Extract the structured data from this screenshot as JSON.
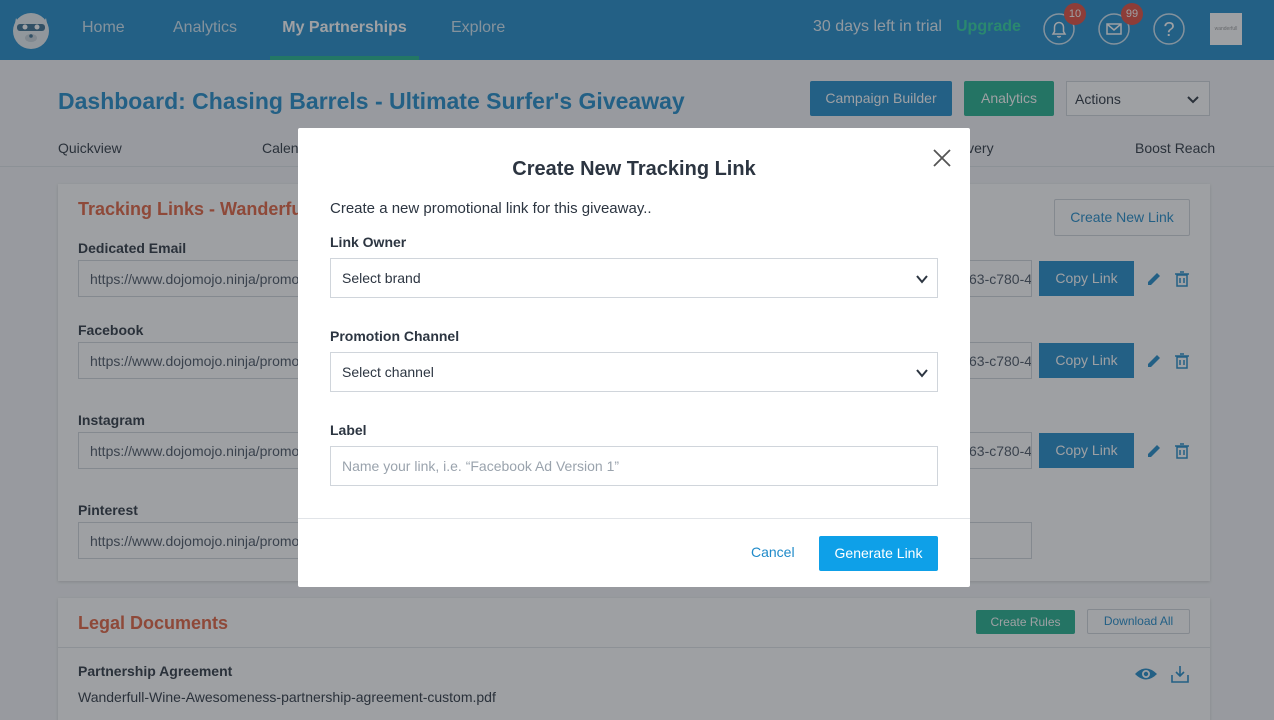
{
  "nav": {
    "items": [
      {
        "label": "Home"
      },
      {
        "label": "Analytics"
      },
      {
        "label": "My Partnerships"
      },
      {
        "label": "Explore"
      }
    ],
    "trial_text": "30 days left in trial",
    "upgrade_label": "Upgrade",
    "notifications_count": "10",
    "messages_count": "99",
    "avatar_text": "wanderfull"
  },
  "dashboard": {
    "title": "Dashboard: Chasing Barrels - Ultimate Surfer's Giveaway",
    "campaign_builder_label": "Campaign Builder",
    "analytics_label": "Analytics",
    "actions_label": "Actions",
    "tabs": {
      "quickview": "Quickview",
      "calendar": "Calendar",
      "delivery": "Delivery",
      "boost_reach": "Boost Reach"
    }
  },
  "tracking": {
    "title": "Tracking Links - Wanderfull",
    "create_new_label": "Create New Link",
    "copy_label": "Copy Link",
    "links": [
      {
        "label": "Dedicated Email",
        "url": "https://www.dojomojo.ninja/promo",
        "url_tail": "63-c780-42"
      },
      {
        "label": "Facebook",
        "url": "https://www.dojomojo.ninja/promo",
        "url_tail": "63-c780-42"
      },
      {
        "label": "Instagram",
        "url": "https://www.dojomojo.ninja/promo",
        "url_tail": "63-c780-42"
      },
      {
        "label": "Pinterest",
        "url": "https://www.dojomojo.ninja/promo",
        "url_tail": ""
      }
    ]
  },
  "legal": {
    "title": "Legal Documents",
    "create_rules_label": "Create Rules",
    "download_all_label": "Download All",
    "doc_title": "Partnership Agreement",
    "doc_file": "Wanderfull-Wine-Awesomeness-partnership-agreement-custom.pdf"
  },
  "modal": {
    "title": "Create New Tracking Link",
    "description": "Create a new promotional link for this giveaway..",
    "owner_label": "Link Owner",
    "owner_value": "Select brand",
    "channel_label": "Promotion Channel",
    "channel_value": "Select channel",
    "label_label": "Label",
    "label_placeholder": "Name your link, i.e. “Facebook Ad Version 1”",
    "cancel_label": "Cancel",
    "generate_label": "Generate Link"
  },
  "colors": {
    "brand_blue": "#1f8ac9",
    "brand_green": "#21b08d",
    "accent_orange": "#e2613f",
    "badge_red": "#e04b3c"
  }
}
